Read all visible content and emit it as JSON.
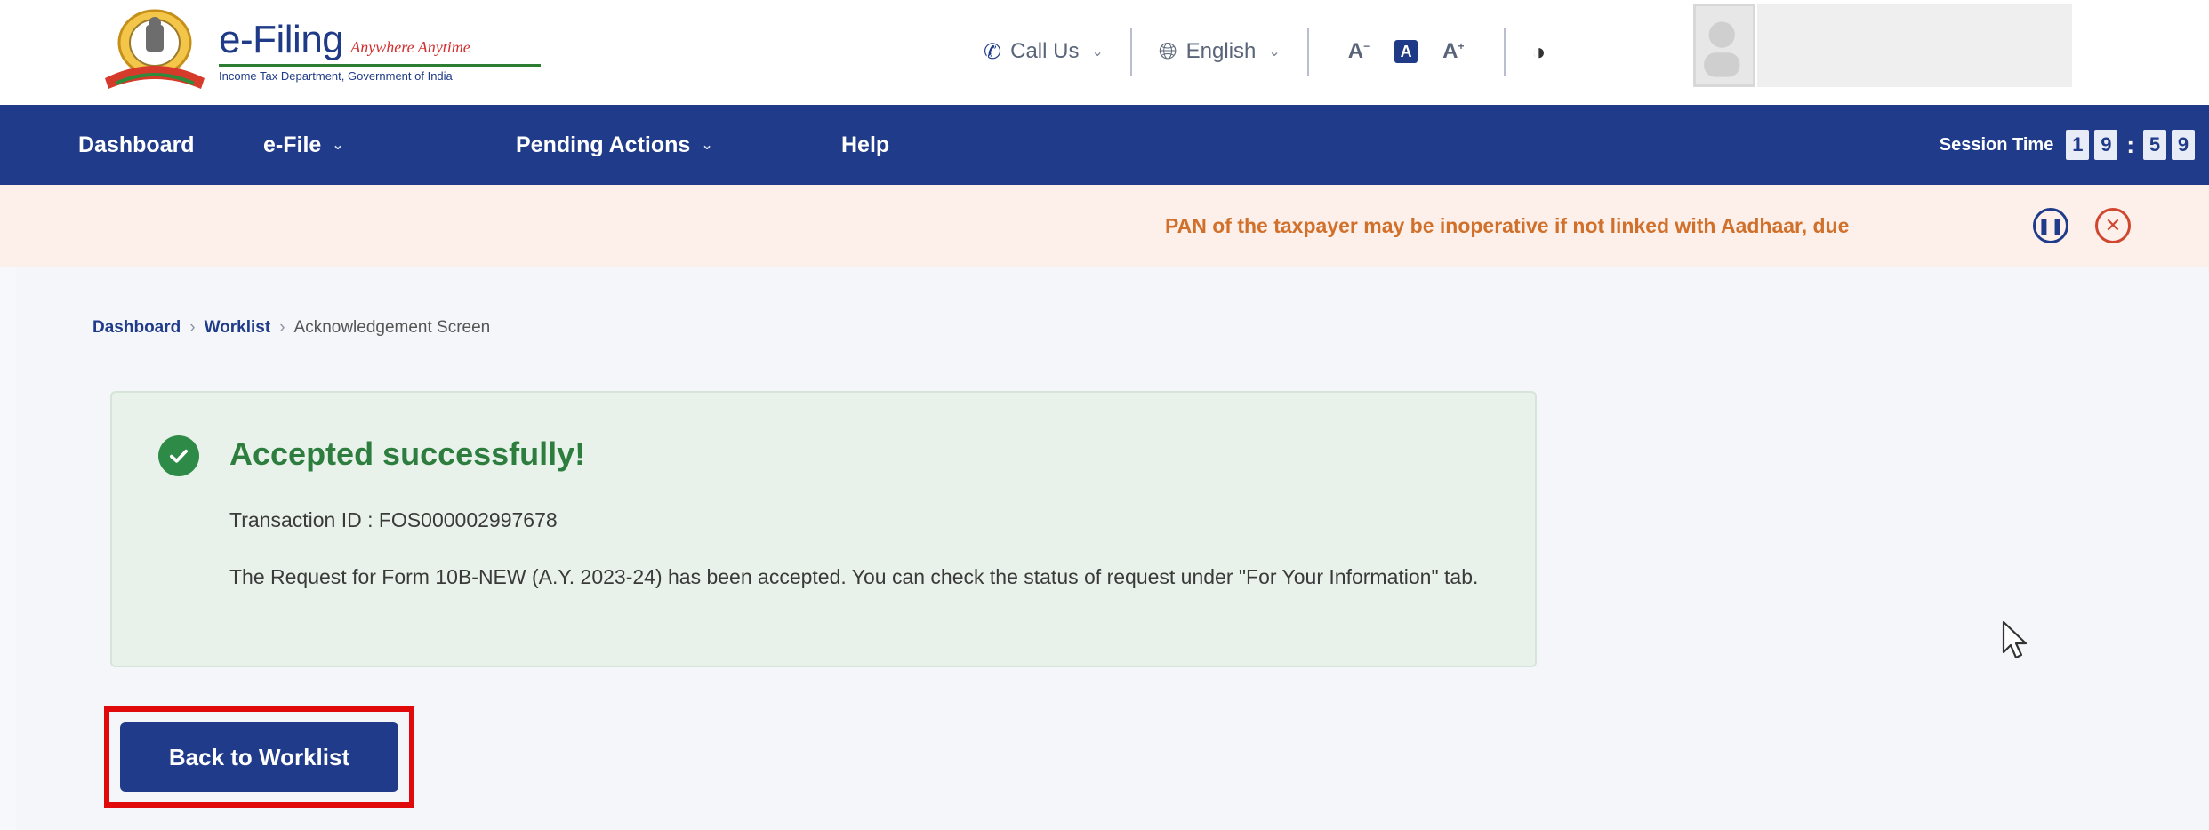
{
  "header": {
    "brand_name": "e-Filing",
    "brand_tagline": "Anywhere Anytime",
    "brand_subtitle": "Income Tax Department, Government of India",
    "call_us": "Call Us",
    "language": "English",
    "font_decrease": "A",
    "font_default": "A",
    "font_increase": "A"
  },
  "nav": {
    "items": [
      {
        "label": "Dashboard"
      },
      {
        "label": "e-File"
      },
      {
        "label": "Pending Actions"
      },
      {
        "label": "Help"
      }
    ],
    "session_label": "Session Time",
    "session_digits": [
      "1",
      "9",
      "5",
      "9"
    ]
  },
  "banner": {
    "text": "PAN of the taxpayer may be inoperative if not linked with Aadhaar, due"
  },
  "breadcrumb": {
    "items": [
      "Dashboard",
      "Worklist",
      "Acknowledgement Screen"
    ]
  },
  "success": {
    "title": "Accepted successfully!",
    "transaction": "Transaction ID : FOS000002997678",
    "message": "The Request for Form 10B-NEW (A.Y. 2023-24) has been accepted. You can check the status of request under \"For Your Information\" tab."
  },
  "actions": {
    "back_label": "Back to Worklist"
  },
  "colors": {
    "nav_bg": "#1f3b8a",
    "banner_text": "#d0702a",
    "success_green": "#2d7d3e",
    "highlight_red": "#e10a0a"
  }
}
